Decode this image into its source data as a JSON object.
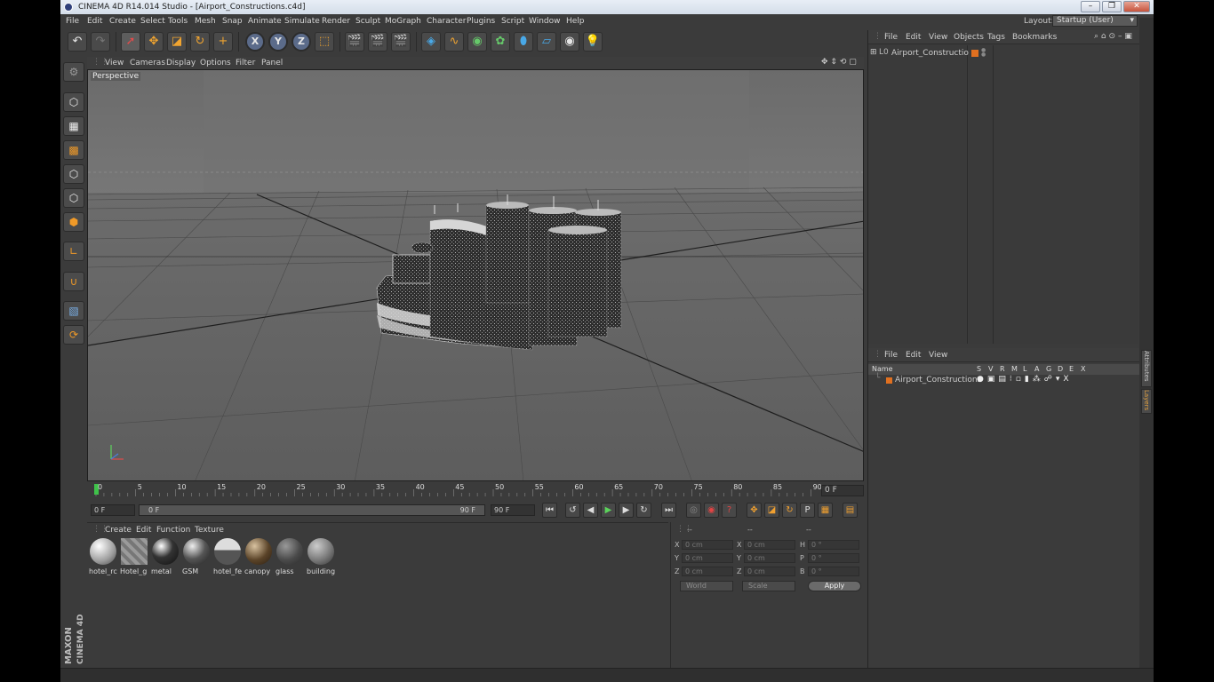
{
  "window": {
    "title": "CINEMA 4D R14.014 Studio - [Airport_Constructions.c4d]",
    "controls": [
      "–",
      "❐",
      "✕"
    ]
  },
  "menubar": {
    "items": [
      "File",
      "Edit",
      "Create",
      "Select",
      "Tools",
      "Mesh",
      "Snap",
      "Animate",
      "Simulate",
      "Render",
      "Sculpt",
      "MoGraph",
      "Character",
      "Plugins",
      "Script",
      "Window",
      "Help"
    ],
    "layout_label": "Layout:",
    "layout_value": "Startup (User)"
  },
  "viewport": {
    "menu": [
      "View",
      "Cameras",
      "Display",
      "Options",
      "Filter",
      "Panel"
    ],
    "label": "Perspective"
  },
  "timeline": {
    "ticks": [
      "0",
      "5",
      "10",
      "15",
      "20",
      "25",
      "30",
      "35",
      "40",
      "45",
      "50",
      "55",
      "60",
      "65",
      "70",
      "75",
      "80",
      "85",
      "90"
    ],
    "current_frame": "0 F",
    "start_frame": "0 F",
    "range_start": "0 F",
    "range_end": "90 F",
    "end_frame": "90 F"
  },
  "materials": {
    "menu": [
      "Create",
      "Edit",
      "Function",
      "Texture"
    ],
    "items": [
      {
        "name": "hotel_rc"
      },
      {
        "name": "Hotel_g"
      },
      {
        "name": "metal"
      },
      {
        "name": "GSM"
      },
      {
        "name": "hotel_fe"
      },
      {
        "name": "canopy"
      },
      {
        "name": "glass"
      },
      {
        "name": "building"
      }
    ]
  },
  "coordinates": {
    "headers": [
      "--",
      "--",
      "--"
    ],
    "rows": [
      {
        "a": "X",
        "av": "0 cm",
        "b": "X",
        "bv": "0 cm",
        "c": "H",
        "cv": "0 °"
      },
      {
        "a": "Y",
        "av": "0 cm",
        "b": "Y",
        "bv": "0 cm",
        "c": "P",
        "cv": "0 °"
      },
      {
        "a": "Z",
        "av": "0 cm",
        "b": "Z",
        "bv": "0 cm",
        "c": "B",
        "cv": "0 °"
      }
    ],
    "mode1": "World",
    "mode2": "Scale",
    "apply": "Apply"
  },
  "object_manager": {
    "menu": [
      "File",
      "Edit",
      "View",
      "Objects",
      "Tags",
      "Bookmarks"
    ],
    "objects": [
      {
        "name": "Airport_Constructions"
      }
    ]
  },
  "layer_manager": {
    "menu": [
      "File",
      "Edit",
      "View"
    ],
    "columns": [
      "Name",
      "S",
      "V",
      "R",
      "M",
      "L",
      "A",
      "G",
      "D",
      "E",
      "X"
    ],
    "layers": [
      {
        "name": "Airport_Constructions"
      }
    ]
  },
  "side_tabs": [
    "Attributes",
    "Layers"
  ],
  "branding": {
    "brand": "MAXON",
    "product": "CINEMA 4D"
  },
  "colors": {
    "ui_bg": "#3b3b3b",
    "viewport_bg": "#6a6a6a",
    "accent_orange": "#f0a430",
    "layer_orange": "#e07020",
    "active_green": "#5bd35b"
  }
}
